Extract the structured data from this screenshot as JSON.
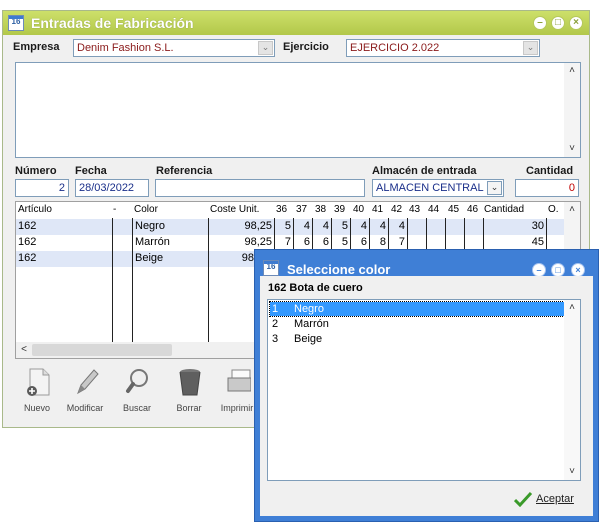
{
  "main_window": {
    "title": "Entradas de Fabricación",
    "empresa_label": "Empresa",
    "empresa_value": "Denim Fashion S.L.",
    "ejercicio_label": "Ejercicio",
    "ejercicio_value": "EJERCICIO 2.022",
    "numero_label": "Número",
    "numero_value": "2",
    "fecha_label": "Fecha",
    "fecha_value": "28/03/2022",
    "referencia_label": "Referencia",
    "referencia_value": "",
    "almacen_label": "Almacén de entrada",
    "almacen_value": "ALMACEN CENTRAL",
    "cantidad_label": "Cantidad",
    "cantidad_value": "0"
  },
  "grid": {
    "headers": [
      "Artículo",
      "-",
      "Color",
      "Coste Unit.",
      "36",
      "37",
      "38",
      "39",
      "40",
      "41",
      "42",
      "43",
      "44",
      "45",
      "46",
      "Cantidad",
      "O."
    ],
    "rows": [
      {
        "articulo": "162",
        "color": "Negro",
        "coste": "98,25",
        "sizes": [
          "5",
          "4",
          "4",
          "5",
          "4",
          "4",
          "4"
        ],
        "cantidad": "30"
      },
      {
        "articulo": "162",
        "color": "Marrón",
        "coste": "98,25",
        "sizes": [
          "7",
          "6",
          "6",
          "5",
          "6",
          "8",
          "7"
        ],
        "cantidad": "45"
      },
      {
        "articulo": "162",
        "color": "Beige",
        "coste": "98",
        "sizes": [],
        "cantidad": ""
      }
    ]
  },
  "toolbar": {
    "nuevo": "Nuevo",
    "modificar": "Modificar",
    "buscar": "Buscar",
    "borrar": "Borrar",
    "imprimir": "Imprimir"
  },
  "dialog": {
    "title": "Seleccione color",
    "subtitle": "162 Bota de cuero",
    "items": [
      {
        "num": "1",
        "name": "Negro"
      },
      {
        "num": "2",
        "name": "Marrón"
      },
      {
        "num": "3",
        "name": "Beige"
      }
    ],
    "accept_label": "Aceptar"
  },
  "colors": {
    "main_titlebar": "#b8cc52",
    "dialog_titlebar": "#3f7fd6",
    "selection": "#3399ff",
    "row_highlight": "#dfe7f7",
    "field_text": "#1a2f8a"
  }
}
